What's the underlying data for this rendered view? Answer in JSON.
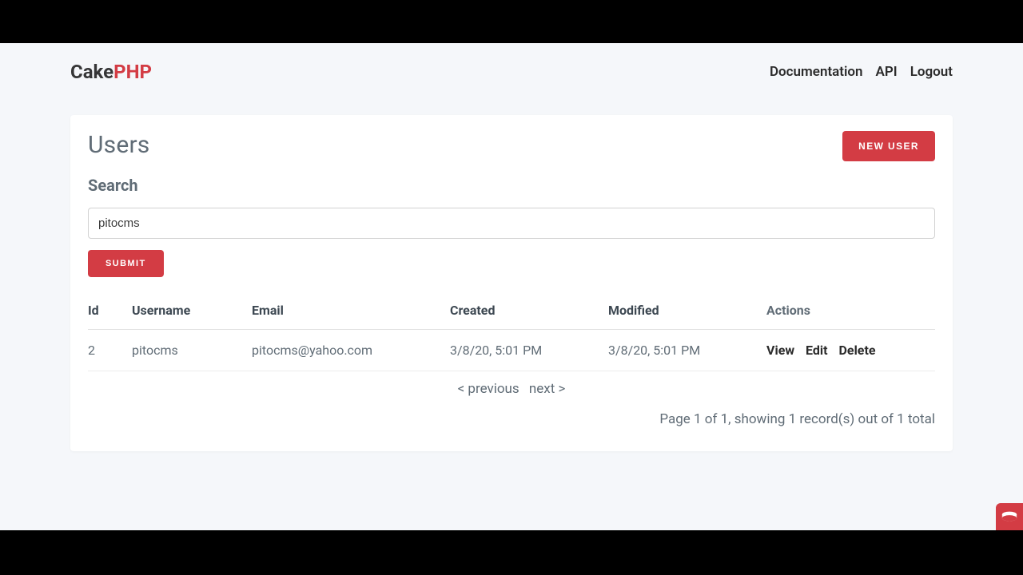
{
  "brand": {
    "part1": "Cake",
    "part2": "PHP"
  },
  "nav": {
    "documentation": "Documentation",
    "api": "API",
    "logout": "Logout"
  },
  "page": {
    "title": "Users",
    "new_user_btn": "New User",
    "search_label": "Search",
    "search_value": "pitocms",
    "submit_btn": "Submit"
  },
  "table": {
    "headers": {
      "id": "Id",
      "username": "Username",
      "email": "Email",
      "created": "Created",
      "modified": "Modified",
      "actions": "Actions"
    },
    "row": {
      "id": "2",
      "username": "pitocms",
      "email": "pitocms@yahoo.com",
      "created": "3/8/20, 5:01 PM",
      "modified": "3/8/20, 5:01 PM"
    },
    "actions": {
      "view": "View",
      "edit": "Edit",
      "delete": "Delete"
    }
  },
  "pagination": {
    "prev": "< previous",
    "next": "next >",
    "summary": "Page 1 of 1, showing 1 record(s) out of 1 total"
  }
}
